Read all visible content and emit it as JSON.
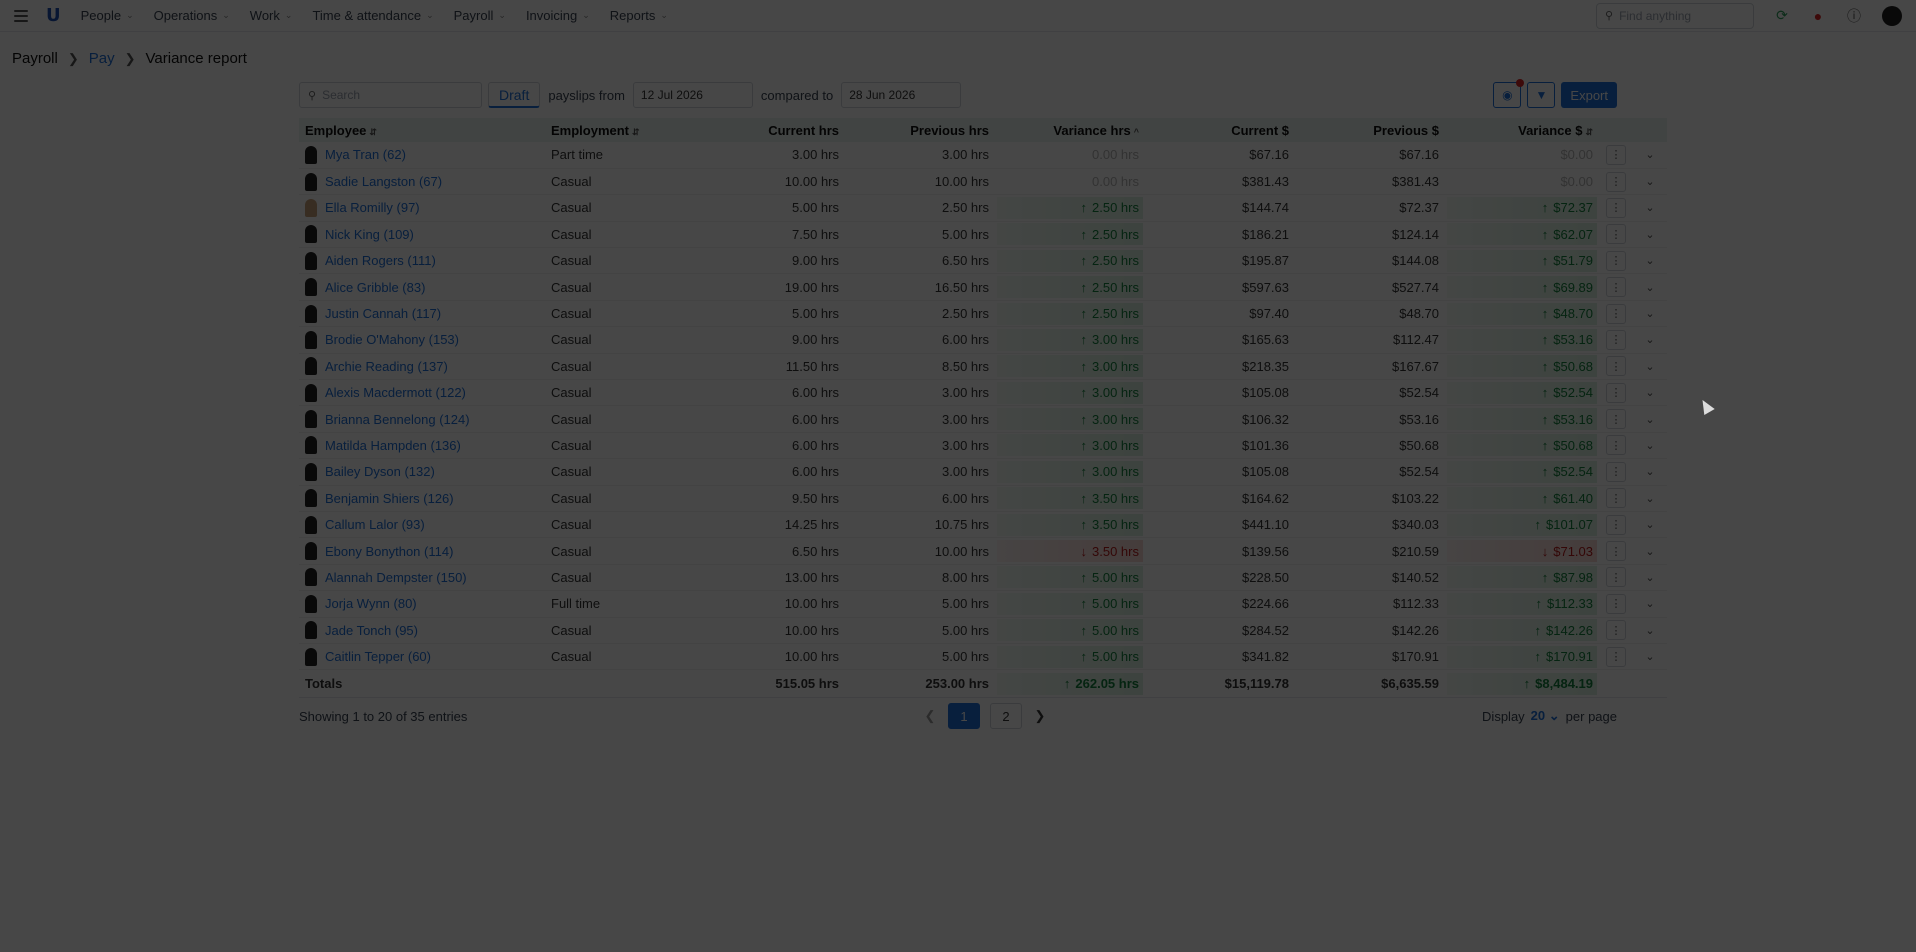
{
  "nav": {
    "items": [
      "People",
      "Operations",
      "Work",
      "Time & attendance",
      "Payroll",
      "Invoicing",
      "Reports"
    ],
    "find_placeholder": "Find anything"
  },
  "breadcrumb": {
    "root": "Payroll",
    "mid": "Pay",
    "current": "Variance report"
  },
  "toolbar": {
    "search_placeholder": "Search",
    "draft": "Draft",
    "payslips_from": "payslips from",
    "from_date": "12 Jul 2026",
    "compared_to": "compared to",
    "to_date": "28 Jun 2026",
    "export": "Export"
  },
  "columns": [
    "Employee",
    "Employment",
    "Current hrs",
    "Previous hrs",
    "Variance hrs",
    "Current $",
    "Previous $",
    "Variance $"
  ],
  "rows": [
    {
      "name": "Mya Tran (62)",
      "emp": "Part time",
      "cur_hrs": "3.00 hrs",
      "prev_hrs": "3.00 hrs",
      "var_hrs": "0.00 hrs",
      "cur_d": "$67.16",
      "prev_d": "$67.16",
      "var_d": "$0.00",
      "dir": "zero"
    },
    {
      "name": "Sadie Langston (67)",
      "emp": "Casual",
      "cur_hrs": "10.00 hrs",
      "prev_hrs": "10.00 hrs",
      "var_hrs": "0.00 hrs",
      "cur_d": "$381.43",
      "prev_d": "$381.43",
      "var_d": "$0.00",
      "dir": "zero"
    },
    {
      "name": "Ella Romilly (97)",
      "emp": "Casual",
      "cur_hrs": "5.00 hrs",
      "prev_hrs": "2.50 hrs",
      "var_hrs": "2.50 hrs",
      "cur_d": "$144.74",
      "prev_d": "$72.37",
      "var_d": "$72.37",
      "dir": "up",
      "light": true
    },
    {
      "name": "Nick King (109)",
      "emp": "Casual",
      "cur_hrs": "7.50 hrs",
      "prev_hrs": "5.00 hrs",
      "var_hrs": "2.50 hrs",
      "cur_d": "$186.21",
      "prev_d": "$124.14",
      "var_d": "$62.07",
      "dir": "up"
    },
    {
      "name": "Aiden Rogers (111)",
      "emp": "Casual",
      "cur_hrs": "9.00 hrs",
      "prev_hrs": "6.50 hrs",
      "var_hrs": "2.50 hrs",
      "cur_d": "$195.87",
      "prev_d": "$144.08",
      "var_d": "$51.79",
      "dir": "up"
    },
    {
      "name": "Alice Gribble (83)",
      "emp": "Casual",
      "cur_hrs": "19.00 hrs",
      "prev_hrs": "16.50 hrs",
      "var_hrs": "2.50 hrs",
      "cur_d": "$597.63",
      "prev_d": "$527.74",
      "var_d": "$69.89",
      "dir": "up"
    },
    {
      "name": "Justin Cannah (117)",
      "emp": "Casual",
      "cur_hrs": "5.00 hrs",
      "prev_hrs": "2.50 hrs",
      "var_hrs": "2.50 hrs",
      "cur_d": "$97.40",
      "prev_d": "$48.70",
      "var_d": "$48.70",
      "dir": "up"
    },
    {
      "name": "Brodie O'Mahony (153)",
      "emp": "Casual",
      "cur_hrs": "9.00 hrs",
      "prev_hrs": "6.00 hrs",
      "var_hrs": "3.00 hrs",
      "cur_d": "$165.63",
      "prev_d": "$112.47",
      "var_d": "$53.16",
      "dir": "up"
    },
    {
      "name": "Archie Reading (137)",
      "emp": "Casual",
      "cur_hrs": "11.50 hrs",
      "prev_hrs": "8.50 hrs",
      "var_hrs": "3.00 hrs",
      "cur_d": "$218.35",
      "prev_d": "$167.67",
      "var_d": "$50.68",
      "dir": "up"
    },
    {
      "name": "Alexis Macdermott (122)",
      "emp": "Casual",
      "cur_hrs": "6.00 hrs",
      "prev_hrs": "3.00 hrs",
      "var_hrs": "3.00 hrs",
      "cur_d": "$105.08",
      "prev_d": "$52.54",
      "var_d": "$52.54",
      "dir": "up"
    },
    {
      "name": "Brianna Bennelong (124)",
      "emp": "Casual",
      "cur_hrs": "6.00 hrs",
      "prev_hrs": "3.00 hrs",
      "var_hrs": "3.00 hrs",
      "cur_d": "$106.32",
      "prev_d": "$53.16",
      "var_d": "$53.16",
      "dir": "up"
    },
    {
      "name": "Matilda Hampden (136)",
      "emp": "Casual",
      "cur_hrs": "6.00 hrs",
      "prev_hrs": "3.00 hrs",
      "var_hrs": "3.00 hrs",
      "cur_d": "$101.36",
      "prev_d": "$50.68",
      "var_d": "$50.68",
      "dir": "up"
    },
    {
      "name": "Bailey Dyson (132)",
      "emp": "Casual",
      "cur_hrs": "6.00 hrs",
      "prev_hrs": "3.00 hrs",
      "var_hrs": "3.00 hrs",
      "cur_d": "$105.08",
      "prev_d": "$52.54",
      "var_d": "$52.54",
      "dir": "up"
    },
    {
      "name": "Benjamin Shiers (126)",
      "emp": "Casual",
      "cur_hrs": "9.50 hrs",
      "prev_hrs": "6.00 hrs",
      "var_hrs": "3.50 hrs",
      "cur_d": "$164.62",
      "prev_d": "$103.22",
      "var_d": "$61.40",
      "dir": "up"
    },
    {
      "name": "Callum Lalor (93)",
      "emp": "Casual",
      "cur_hrs": "14.25 hrs",
      "prev_hrs": "10.75 hrs",
      "var_hrs": "3.50 hrs",
      "cur_d": "$441.10",
      "prev_d": "$340.03",
      "var_d": "$101.07",
      "dir": "up"
    },
    {
      "name": "Ebony Bonython (114)",
      "emp": "Casual",
      "cur_hrs": "6.50 hrs",
      "prev_hrs": "10.00 hrs",
      "var_hrs": "3.50 hrs",
      "cur_d": "$139.56",
      "prev_d": "$210.59",
      "var_d": "$71.03",
      "dir": "down"
    },
    {
      "name": "Alannah Dempster (150)",
      "emp": "Casual",
      "cur_hrs": "13.00 hrs",
      "prev_hrs": "8.00 hrs",
      "var_hrs": "5.00 hrs",
      "cur_d": "$228.50",
      "prev_d": "$140.52",
      "var_d": "$87.98",
      "dir": "up"
    },
    {
      "name": "Jorja Wynn (80)",
      "emp": "Full time",
      "cur_hrs": "10.00 hrs",
      "prev_hrs": "5.00 hrs",
      "var_hrs": "5.00 hrs",
      "cur_d": "$224.66",
      "prev_d": "$112.33",
      "var_d": "$112.33",
      "dir": "up"
    },
    {
      "name": "Jade Tonch (95)",
      "emp": "Casual",
      "cur_hrs": "10.00 hrs",
      "prev_hrs": "5.00 hrs",
      "var_hrs": "5.00 hrs",
      "cur_d": "$284.52",
      "prev_d": "$142.26",
      "var_d": "$142.26",
      "dir": "up"
    },
    {
      "name": "Caitlin Tepper (60)",
      "emp": "Casual",
      "cur_hrs": "10.00 hrs",
      "prev_hrs": "5.00 hrs",
      "var_hrs": "5.00 hrs",
      "cur_d": "$341.82",
      "prev_d": "$170.91",
      "var_d": "$170.91",
      "dir": "up"
    }
  ],
  "totals": {
    "label": "Totals",
    "cur_hrs": "515.05 hrs",
    "prev_hrs": "253.00 hrs",
    "var_hrs": "262.05 hrs",
    "cur_d": "$15,119.78",
    "prev_d": "$6,635.59",
    "var_d": "$8,484.19"
  },
  "footer": {
    "showing": "Showing 1 to 20 of 35 entries",
    "pages": [
      "1",
      "2"
    ],
    "display": "Display",
    "per_page_value": "20",
    "per_page": "per page"
  }
}
